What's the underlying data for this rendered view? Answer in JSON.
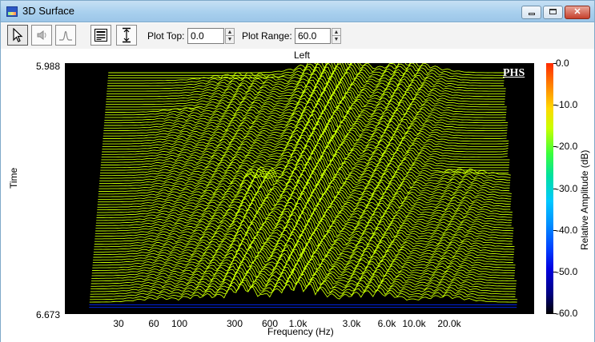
{
  "window": {
    "title": "3D Surface",
    "close_label": "✕"
  },
  "toolbar": {
    "plot_top_label": "Plot Top:",
    "plot_top_value": "0.0",
    "plot_range_label": "Plot Range:",
    "plot_range_value": "60.0"
  },
  "plot": {
    "title": "Left",
    "ylabel": "Time",
    "y_top": "5.988",
    "y_bottom": "6.673",
    "xlabel": "Frequency (Hz)",
    "badge": "PHS",
    "x_ticks": [
      "30",
      "60",
      "100",
      "300",
      "600",
      "1.0k",
      "3.0k",
      "6.0k",
      "10.0k",
      "20.0k"
    ]
  },
  "colorbar": {
    "title": "Relative Amplitude (dB)",
    "ticks": [
      "0.0",
      "-10.0",
      "-20.0",
      "-30.0",
      "-40.0",
      "-50.0",
      "-60.0"
    ]
  },
  "chart_data": {
    "type": "heatmap",
    "title": "Left",
    "xlabel": "Frequency (Hz)",
    "ylabel": "Time",
    "x_scale": "log",
    "x_ticks": [
      30,
      60,
      100,
      300,
      600,
      1000,
      3000,
      6000,
      10000,
      20000
    ],
    "y_range": [
      5.988,
      6.673
    ],
    "z_label": "Relative Amplitude (dB)",
    "z_range": [
      -60,
      0
    ],
    "colorbar_ticks": [
      0,
      -10,
      -20,
      -30,
      -40,
      -50,
      -60
    ]
  }
}
